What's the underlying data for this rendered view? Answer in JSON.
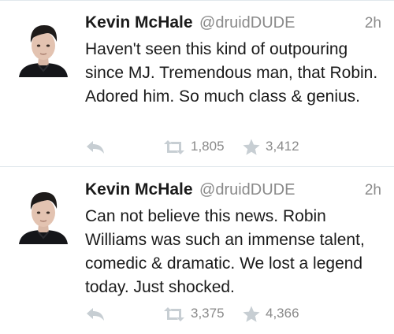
{
  "tweets": [
    {
      "display_name": "Kevin McHale",
      "handle": "@druidDUDE",
      "timestamp": "2h",
      "text": "Haven't seen this kind of outpouring since MJ. Tremendous man, that Robin. Adored him. So much class & genius.",
      "retweets": "1,805",
      "favorites": "3,412"
    },
    {
      "display_name": "Kevin McHale",
      "handle": "@druidDUDE",
      "timestamp": "2h",
      "text": "Can not believe this news. Robin Williams was such an immense talent, comedic & dramatic. We lost a legend today. Just shocked.",
      "retweets": "3,375",
      "favorites": "4,366"
    }
  ],
  "icons": {
    "reply": "reply-icon",
    "retweet": "retweet-icon",
    "favorite": "star-icon",
    "avatar": "avatar"
  },
  "colors": {
    "text": "#1a1a1a",
    "muted": "#8a8a8a",
    "icon": "#c7ced3",
    "divider": "#e1e8ed"
  }
}
